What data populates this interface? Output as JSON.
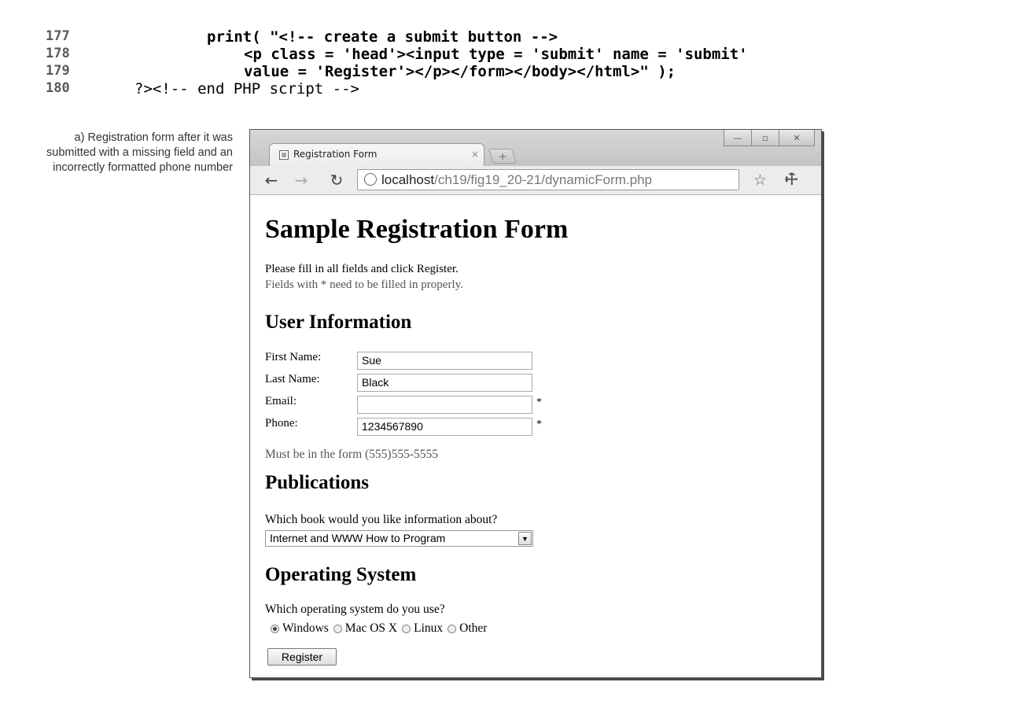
{
  "code_listing": [
    {
      "line": "177",
      "text": "print( \"<!-- create a submit button -->"
    },
    {
      "line": "178",
      "text": "<p class = 'head'><input type = 'submit' name = 'submit'"
    },
    {
      "line": "179",
      "text": "value = 'Register'></p></form></body></html>\" );"
    },
    {
      "line": "180",
      "text": "?><!-- end PHP script -->"
    }
  ],
  "caption": "a) Registration form after it was submitted with a missing field and an incorrectly formatted phone number",
  "browser": {
    "tab_title": "Registration Form",
    "tab_close": "×",
    "new_tab": "+",
    "url_host": "localhost",
    "url_path": "/ch19/fig19_20-21/dynamicForm.php",
    "window_controls": {
      "minimize": "—",
      "maximize": "▫",
      "close": "✕"
    },
    "icons": [
      "back-arrow-icon",
      "forward-arrow-icon",
      "reload-icon",
      "page-icon",
      "star-icon",
      "wrench-icon"
    ]
  },
  "page": {
    "title": "Sample Registration Form",
    "instructions": "Please fill in all fields and click Register.",
    "error_notice": "Fields with * need to be filled in properly.",
    "user_section_heading": "User Information",
    "fields": [
      {
        "label": "First Name:",
        "value": "Sue",
        "required_mark": ""
      },
      {
        "label": "Last Name:",
        "value": "Black",
        "required_mark": ""
      },
      {
        "label": "Email:",
        "value": "",
        "required_mark": "*"
      },
      {
        "label": "Phone:",
        "value": "1234567890",
        "required_mark": "*"
      }
    ],
    "phone_hint": "Must be in the form (555)555-5555",
    "publications_heading": "Publications",
    "book_question": "Which book would you like information about?",
    "book_selected": "Internet and WWW How to Program",
    "os_heading": "Operating System",
    "os_question": "Which operating system do you use?",
    "os_options": [
      {
        "label": "Windows",
        "checked": true
      },
      {
        "label": "Mac OS X",
        "checked": false
      },
      {
        "label": "Linux",
        "checked": false
      },
      {
        "label": "Other",
        "checked": false
      }
    ],
    "submit_label": "Register"
  }
}
